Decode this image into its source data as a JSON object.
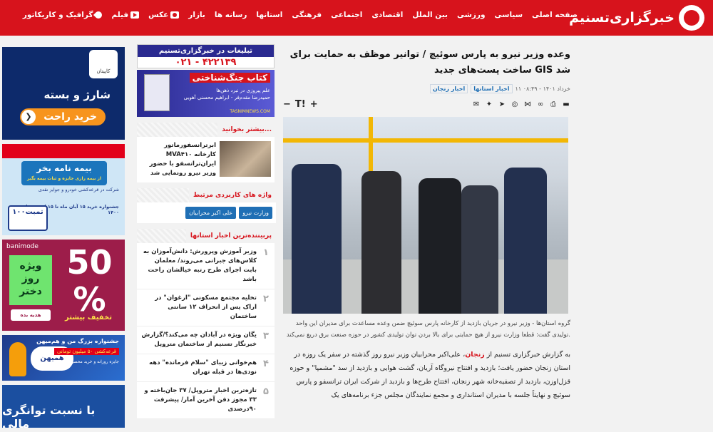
{
  "header": {
    "logo_text": "خبرگزاری‌تسنیم",
    "nav": [
      {
        "label": "صفحه اصلی",
        "icon": ""
      },
      {
        "label": "سیاسی",
        "icon": ""
      },
      {
        "label": "ورزشی",
        "icon": ""
      },
      {
        "label": "بین الملل",
        "icon": ""
      },
      {
        "label": "اقتصادی",
        "icon": ""
      },
      {
        "label": "اجتماعی",
        "icon": ""
      },
      {
        "label": "فرهنگی",
        "icon": ""
      },
      {
        "label": "استانها",
        "icon": ""
      },
      {
        "label": "رسانه ها",
        "icon": ""
      },
      {
        "label": "بازار",
        "icon": ""
      },
      {
        "label": "عکس",
        "icon": "camera-icon"
      },
      {
        "label": "فیلم",
        "icon": "play-icon"
      },
      {
        "label": "گرافیک و کاریکاتور",
        "icon": "brush-icon"
      }
    ]
  },
  "left_ads": {
    "ad1": {
      "brand": "کاپیتان",
      "line1": "شارژ و بسته",
      "button": "خرید راحت"
    },
    "ad2": {
      "title": "بیمه نامه بخر",
      "subtitle": "از بیمه رازی جایزه و ثبات بیمه بگیر",
      "line1": "شرکت در قرعه‌کشی خودرو و جوایز نقدی",
      "line2": "جشنواره خرید ۱۵ آبان ماه تا ۱۵ اسفند ماه ۱۴۰۰",
      "phone": "۱۰۰تمبت"
    },
    "ad3": {
      "brand": "banimode",
      "pct": "50 %",
      "pct_sub": "تخفیف بیشتر",
      "green": "ویژه روز دختر",
      "gift": "هدیه بده"
    },
    "ad4": {
      "line1": "جشنواره بزرگ من و هم‌میهن",
      "line2": "قرعه‌کشی ۵۰ میلیون تومانی",
      "line3": "جایزه روزانه و خرید محصولات هم‌میهن",
      "badge": "همیهن"
    },
    "ad5": {
      "text": "با نسبت توانگری مالی"
    }
  },
  "middle": {
    "ad_tasnim": {
      "title": "تبلیغات در خبرگزاری‌تسنیم",
      "phone": "۰۲۱ - ۴۲۲۱۳۹"
    },
    "ad_book": {
      "title": "کتاب جنگ‌شناختی",
      "sub": "علم پیروزی در نبرد ذهن‌ها",
      "authors": "حمیدرضا مقدم‌فر - ابراهیم محسنی آهویی",
      "url": "TASNIMNEWS.COM"
    },
    "more_head": "بیشتر بخوانید...",
    "related_text": "ابرترانسفورماتور MVA۴۱۰ کارخانه ایران‌ترانسفو با حضور وزیر نیرو رونمایی شد",
    "tags_head": "واژه های کاربردی مرتبط",
    "tags": [
      "وزارت نیرو",
      "علی اکبر محرابیان"
    ],
    "popular_head": "پربیننده‌ترین اخبار استانها",
    "popular": [
      {
        "num": "۱",
        "text": "وزیر آموزش وپرورش: دانش‌آموزان به کلاس‌های جبرانی می‌روند/ معلمان بابت اجرای طرح رتبه خیالشان راحت باشد"
      },
      {
        "num": "۲",
        "text": "تخلیه مجتمع مسکونی \"ارغوان\" در اراک پس از انحراف ۱۲ سانتی ساختمان"
      },
      {
        "num": "۳",
        "text": "یگان ویژه در آبادان چه می‌کند؟/گزارش خبرنگار تسنیم از ساختمان متروپل"
      },
      {
        "num": "۴",
        "text": "هم‌خوانی زیبای \"سلام فرمانده\" دهه نودی‌ها در قبله تهران"
      },
      {
        "num": "۵",
        "text": "تازه‌ترین اخبار متروپل/ ۳۷ جان‌باخته و ۳۳ مجوز دفن آخرین آمار/ پیشرفت ۹۰درصدی"
      }
    ]
  },
  "article": {
    "title": "وعده وزیر نیرو به پارس سوئیچ / توانیر موظف به حمایت برای ساخت پست‌های جدید GIS شد",
    "date": "۱۱ خرداد ۱۴۰۱ - ۰۸:۴۹",
    "cat1": "اخبار استانها",
    "cat2": "اخبار زنجان",
    "font_plus": "+",
    "font_t": "T!",
    "font_minus": "−",
    "caption": "گروه استان‌ها - وزیر نیرو در جریان بازدید از کارخانه پارس سوئیچ ضمن وعده مساعدت برای مدیران این واحد تولیدی گفت: قطعا وزارت نیرو از هیچ حمایتی برای بالا بردن توان تولیدی کشور در حوزه صنعت برق دریغ نمی‌کند.",
    "body_pre": "به گزارش خبرگزاری تسنیم از",
    "body_link": "زنجان",
    "body_post": "، علی‌اکبر محرابیان وزیر نیرو روز گذشته در سفر یک روزه در استان زنجان حضور یافت؛ بازدید و افتتاح نیروگاه آریان، گشت هوایی و بازدید از سد \"مشمپا\" و حوزه قزل‌اوزن، بازدید از تصفیه‌خانه شهر زنجان، افتتاح طرح‌ها و بازدید از شرکت ایران ترانسفو و پارس سوئیچ و نهایتاً جلسه با مدیران استانداری و مجمع نمایندگان مجلس جزء برنامه‌های یک"
  }
}
